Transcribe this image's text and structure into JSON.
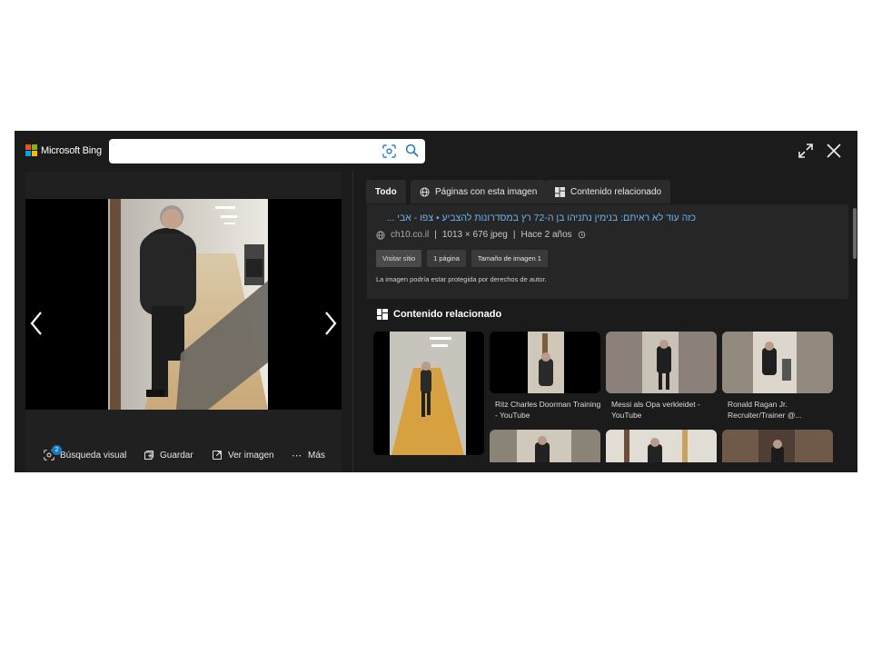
{
  "app": {
    "logo_text": "Microsoft Bing"
  },
  "search": {
    "placeholder": ""
  },
  "icons": {
    "visual_search": "visual-search-icon",
    "search": "search-icon",
    "expand": "expand-icon",
    "close": "close-icon",
    "prev": "chevron-left-icon",
    "next": "chevron-right-icon",
    "save": "save-icon",
    "view_image": "view-image-icon",
    "more": "more-icon",
    "pages": "globe-icon",
    "related": "grid-icon",
    "history": "history-icon"
  },
  "actions": {
    "visual_search_label": "Búsqueda visual",
    "visual_search_badge": "2",
    "save_label": "Guardar",
    "view_image_label": "Ver imagen",
    "more_label": "Más"
  },
  "tabs": [
    {
      "label": "Todo",
      "active": true
    },
    {
      "label": "Páginas con esta imagen",
      "active": false
    },
    {
      "label": "Contenido relacionado",
      "active": false
    }
  ],
  "result": {
    "title": "כזה עוד לא ראיתם: בנימין נתניהו בן ה-72 רץ במסדרונות להצביע • צפו - אבי ...",
    "site": "ch10.co.il",
    "dimensions": "1013 × 676 jpeg",
    "age": "Hace 2 años",
    "visit_button": "Visitar sitio",
    "pages_button": "1 página",
    "size_button": "Tamaño de imagen 1",
    "copyright_notice": "La imagen podría estar protegida por derechos de autor."
  },
  "related": {
    "section_title": "Contenido relacionado",
    "items": [
      {
        "caption": ""
      },
      {
        "caption": "Ritz Charles Doorman Training - YouTube"
      },
      {
        "caption": "Messi als Opa verkleidet - YouTube"
      },
      {
        "caption": "Ronald Ragan Jr. Recruiter/Trainer @..."
      },
      {
        "caption": ""
      },
      {
        "caption": ""
      },
      {
        "caption": ""
      }
    ]
  },
  "colors": {
    "background": "#1b1b1b",
    "panel": "#262626",
    "link": "#6cb4f2",
    "badge": "#1a78c2"
  }
}
